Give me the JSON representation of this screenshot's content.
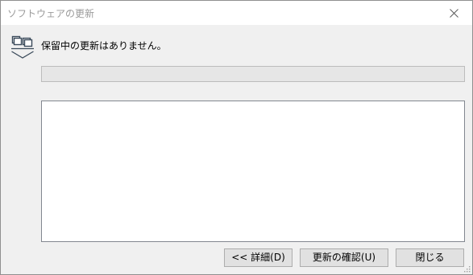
{
  "window": {
    "title": "ソフトウェアの更新"
  },
  "status": {
    "message": "保留中の更新はありません。"
  },
  "progress": {
    "percent": 0
  },
  "details": {
    "text": ""
  },
  "buttons": {
    "details_label": "<< 詳細(D)",
    "check_label": "更新の確認(U)",
    "close_label": "閉じる"
  },
  "icons": {
    "title_close": "close-icon",
    "update": "windows-update-icon",
    "resize": "resize-grip-icon"
  }
}
